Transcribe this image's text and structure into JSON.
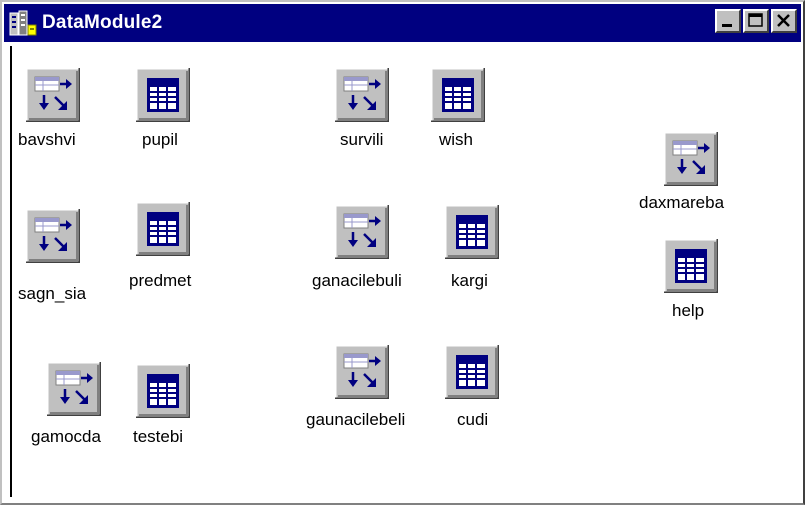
{
  "window": {
    "title": "DataModule2",
    "icon": "datamodule-icon",
    "buttons": [
      "minimize-icon",
      "maximize-icon",
      "close-icon"
    ]
  },
  "components": [
    {
      "name": "bavshvi",
      "icon": "query-icon"
    },
    {
      "name": "pupil",
      "icon": "table-icon"
    },
    {
      "name": "survili",
      "icon": "query-icon"
    },
    {
      "name": "wish",
      "icon": "table-icon"
    },
    {
      "name": "daxmareba",
      "icon": "query-icon"
    },
    {
      "name": "help",
      "icon": "table-icon"
    },
    {
      "name": "sagn_sia",
      "icon": "query-icon"
    },
    {
      "name": "predmet",
      "icon": "table-icon"
    },
    {
      "name": "ganacilebuli",
      "icon": "query-icon"
    },
    {
      "name": "kargi",
      "icon": "table-icon"
    },
    {
      "name": "gamocda",
      "icon": "query-icon"
    },
    {
      "name": "testebi",
      "icon": "table-icon"
    },
    {
      "name": "gaunacilebeli",
      "icon": "query-icon"
    },
    {
      "name": "cudi",
      "icon": "table-icon"
    }
  ]
}
